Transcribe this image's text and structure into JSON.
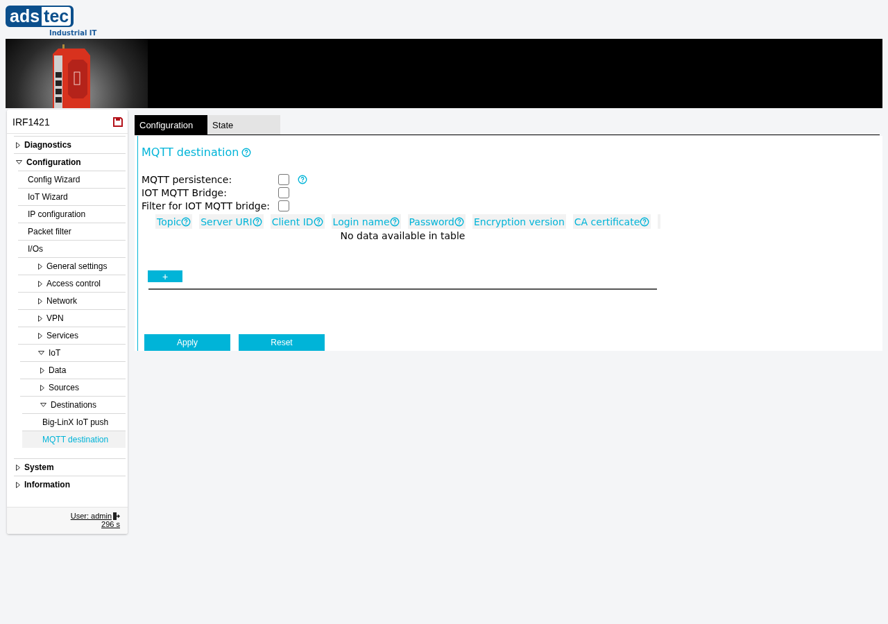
{
  "logo": {
    "part_1": "ads",
    "part_2": "tec",
    "tagline": "Industrial IT"
  },
  "banner": {
    "kind": "picture"
  },
  "sidebar": {
    "device": "IRF1421",
    "items": [
      {
        "label": "Diagnostics",
        "expanded": false,
        "selected": false
      },
      {
        "label": "Configuration",
        "expanded": true,
        "selected": false,
        "children": [
          {
            "label": "Config Wizard",
            "selected": false
          },
          {
            "label": "IoT Wizard",
            "selected": false
          },
          {
            "label": "IP configuration",
            "selected": false
          },
          {
            "label": "Packet filter",
            "selected": false
          },
          {
            "label": "I/Os",
            "selected": false
          },
          {
            "label": "General settings",
            "expanded": false,
            "selected": false
          },
          {
            "label": "Access control",
            "expanded": false,
            "selected": false
          },
          {
            "label": "Network",
            "expanded": false,
            "selected": false
          },
          {
            "label": "VPN",
            "expanded": false,
            "selected": false
          },
          {
            "label": "Services",
            "expanded": false,
            "selected": false
          },
          {
            "label": "IoT",
            "expanded": true,
            "selected": false,
            "children": [
              {
                "label": "Data",
                "expanded": false,
                "selected": false
              },
              {
                "label": "Sources",
                "expanded": false,
                "selected": false
              },
              {
                "label": "Destinations",
                "expanded": true,
                "selected": false,
                "children": [
                  {
                    "label": "Big-LinX IoT push",
                    "selected": false
                  },
                  {
                    "label": "MQTT destination",
                    "selected": true
                  }
                ]
              }
            ]
          }
        ]
      },
      {
        "label": "System",
        "expanded": false,
        "selected": false
      },
      {
        "label": "Information",
        "expanded": false,
        "selected": false
      }
    ],
    "user": "User: admin",
    "timer": "296 s"
  },
  "tabs": [
    {
      "label": "Configuration",
      "selected": true
    },
    {
      "label": "State",
      "selected": false
    }
  ],
  "section": {
    "title": "MQTT destination",
    "fields": [
      {
        "label": "MQTT persistence:",
        "checked": false,
        "help": true
      },
      {
        "label": "IOT MQTT Bridge:",
        "checked": false,
        "help": false
      },
      {
        "label": "Filter for IOT MQTT bridge:",
        "checked": false,
        "help": false
      }
    ],
    "table": {
      "columns": [
        {
          "label": "Topic",
          "help": true
        },
        {
          "label": "Server URI",
          "help": true
        },
        {
          "label": "Client ID",
          "help": true
        },
        {
          "label": "Login name",
          "help": true
        },
        {
          "label": "Password",
          "help": true
        },
        {
          "label": "Encryption version",
          "help": false
        },
        {
          "label": "CA certificate",
          "help": true
        }
      ],
      "empty_message": "No data available in table"
    },
    "add_button": "+"
  },
  "buttons": [
    "Apply",
    "Reset"
  ]
}
